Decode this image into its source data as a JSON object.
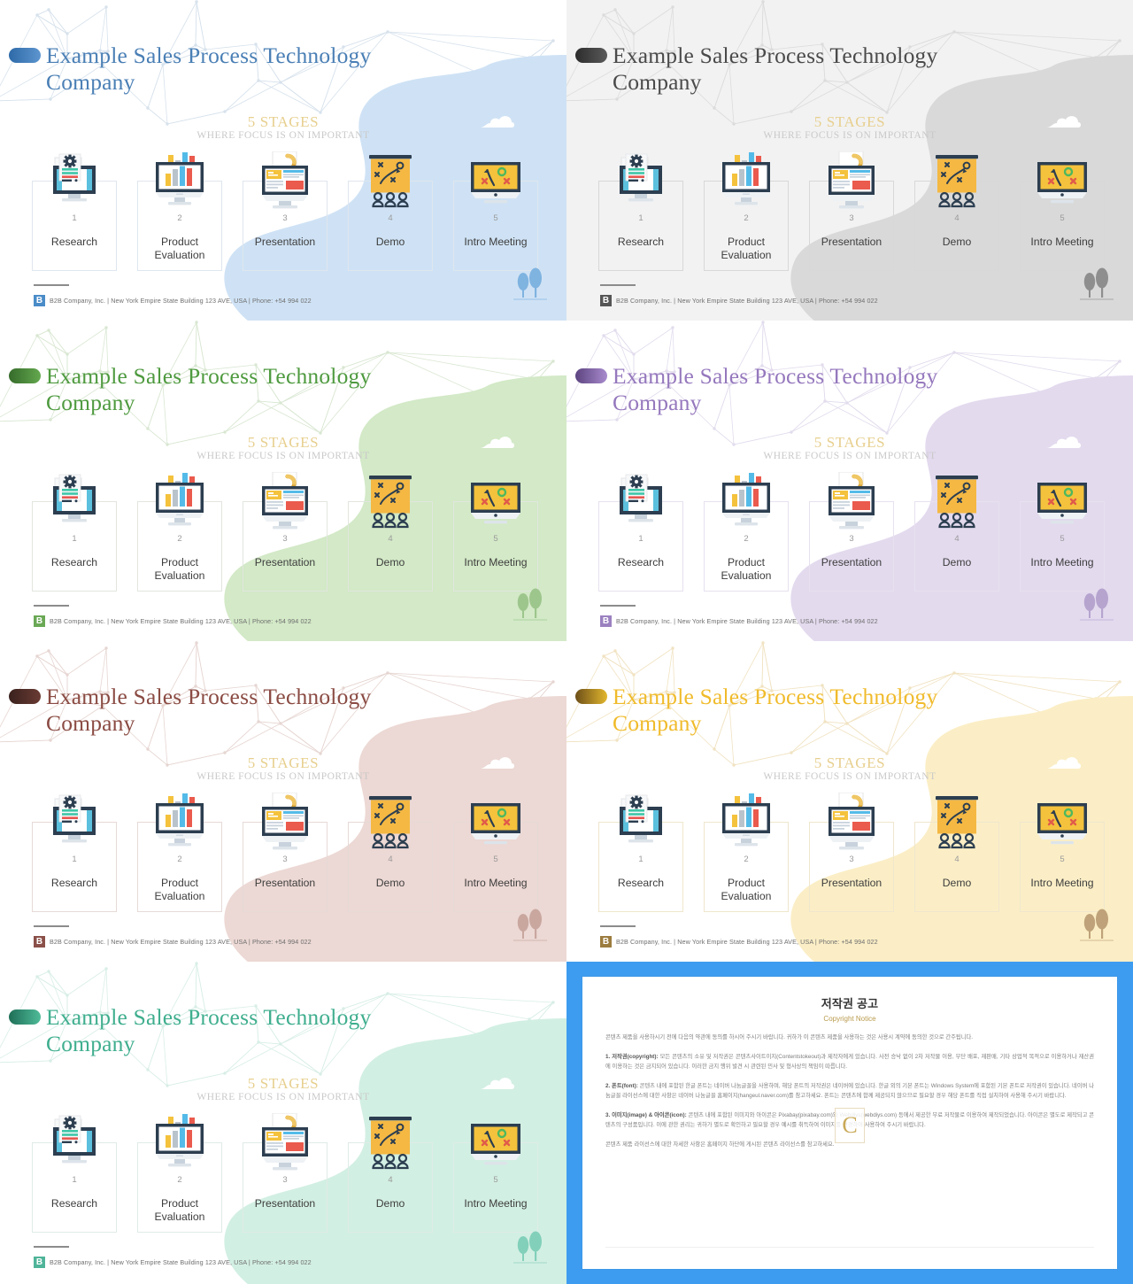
{
  "deck": {
    "title": "Example Sales Process Technology\nCompany",
    "stages_title": "5 STAGES",
    "stages_subtitle": "WHERE FOCUS  IS ON IMPORTANT",
    "footer_logo": "B",
    "footer_text": "B2B Company, Inc.  |  New York Empire State Building 123 AVE, USA  |  Phone: +54 994 022",
    "stages": [
      {
        "num": "1",
        "label": "Research",
        "icon": "monitor-document-gear-icon"
      },
      {
        "num": "2",
        "label": "Product\nEvaluation",
        "icon": "monitor-bar-chart-icon"
      },
      {
        "num": "3",
        "label": "Presentation",
        "icon": "monitor-webpage-hook-icon"
      },
      {
        "num": "4",
        "label": "Demo",
        "icon": "flipchart-strategy-people-icon"
      },
      {
        "num": "5",
        "label": "Intro Meeting",
        "icon": "monitor-strategy-icon"
      }
    ]
  },
  "variants": [
    {
      "name": "blue",
      "title_color": "#4a7fb5",
      "pill_from": "#5d95cf",
      "pill_to": "#2e6aa8",
      "blob": "#cfe2f5",
      "net": "#d7e2ec",
      "card_border": "#dfe6ee",
      "slide_bg": "#ffffff",
      "tree": "#7fb3e0",
      "logo_bg": "#4a8cc8",
      "cloud": "#ffffff"
    },
    {
      "name": "gray",
      "title_color": "#4a4a4a",
      "pill_from": "#5a5a5a",
      "pill_to": "#2c2c2c",
      "blob": "#d9d9d9",
      "net": "#dcdcdc",
      "card_border": "#d8d8d8",
      "slide_bg": "#f2f2f2",
      "tree": "#8e8e8e",
      "logo_bg": "#555555",
      "cloud": "#ffffff"
    },
    {
      "name": "green",
      "title_color": "#4e9a3f",
      "pill_from": "#64a84f",
      "pill_to": "#356b2a",
      "blob": "#d3e9c7",
      "net": "#d9e7d2",
      "card_border": "#e1e6de",
      "slide_bg": "#ffffff",
      "tree": "#9dc68c",
      "logo_bg": "#6aa855",
      "cloud": "#ffffff"
    },
    {
      "name": "purple",
      "title_color": "#9578bd",
      "pill_from": "#a88bcd",
      "pill_to": "#5c4480",
      "blob": "#e3daee",
      "net": "#e2dced",
      "card_border": "#e7e1ef",
      "slide_bg": "#ffffff",
      "tree": "#b6a4cf",
      "logo_bg": "#9b81c0",
      "cloud": "#ffffff"
    },
    {
      "name": "maroon",
      "title_color": "#8a4b43",
      "pill_from": "#6a3b34",
      "pill_to": "#3a211d",
      "blob": "#ecd8d4",
      "net": "#e6d6d2",
      "card_border": "#e6dad7",
      "slide_bg": "#ffffff",
      "tree": "#c9a79f",
      "logo_bg": "#8a5049",
      "cloud": "#ffffff"
    },
    {
      "name": "yellow",
      "title_color": "#f0bb2b",
      "pill_from": "#e2b72e",
      "pill_to": "#6d4f18",
      "blob": "#fbeec6",
      "net": "#f1e3c2",
      "card_border": "#efe6cd",
      "slide_bg": "#ffffff",
      "tree": "#bfa279",
      "logo_bg": "#9c7c3f",
      "cloud": "#ffffff"
    },
    {
      "name": "teal",
      "title_color": "#3fae8e",
      "pill_from": "#4fbb99",
      "pill_to": "#1e6e56",
      "blob": "#d2efe3",
      "net": "#d8eee6",
      "card_border": "#dfebe7",
      "slide_bg": "#ffffff",
      "tree": "#82d0ba",
      "logo_bg": "#4fb499",
      "cloud": "#ffffff"
    }
  ],
  "copyright": {
    "accent": "#3e9cf0",
    "heading": "저작권 공고",
    "subheading": "Copyright Notice",
    "watermark": "C",
    "intro": "콘텐츠 제품을 사용하시기 전에 다음의 약관에 동의를 하시어 주시기 바랍니다. 귀하가 이 콘텐츠 제품을 사용하는 것은 사용시 계약에 동의한 것으로 간주됩니다.",
    "items": [
      {
        "label": "1. 저작권(copyright):",
        "text": " 모든 콘텐츠의 소유 및 저작권은 콘텐츠사이트이지(Contentstokeout)과 제작자에게 있습니다. 사전 승낙 없이 2차 저작물 이용, 무단 배포, 재판매, 기타 상업적 목적으로 이용하거나 재산권에 이용하는 것은 금지되어 있습니다. 이러한 금지 행위 발견 시 관련된 민사 및 형사상의 책임이 따릅니다."
      },
      {
        "label": "2. 폰트(font):",
        "text": " 콘텐츠 내에 포함된 한글 폰트는 네이버 나눔글꼴을 사용하며, 해당 폰트의 저작권은 네이버에 있습니다. 한글 외의 기본 폰트는 Windows System에 포함된 기본 폰트로 저작권이 있습니다. 네이버 나눔글꼴 라이선스에 대한 사항은 네이버 나눔글꼴 홈페이지(hangeul.naver.com)를 참고하세요. 폰트는 콘텐츠에 함께 제공되지 않으므로 필요할 경우 해당 폰트를 직접 설치하여 사용해 주시기 바랍니다."
      },
      {
        "label": "3. 이미지(image) & 아이콘(icon):",
        "text": " 콘텐츠 내에 포함된 이미지와 아이콘은 Pixabay(pixabay.com)와 Webdiys(webdiys.com) 등에서 제공한 무료 저작물로 이용하여 제작되었습니다. 아이콘은 별도로 제작되고 콘텐츠의 구성품입니다. 이에 관한 권리는 귀하가 별도로 확인하고 필요할 경우 예시를 취득하여 이미지를 변경하여 사용하여 주시기 바랍니다."
      }
    ],
    "outro": "콘텐츠 제품 라이선스에 대한 자세한 사항은 홈페이지 하단에 게시된 콘텐츠 라이선스를 참고하세요."
  }
}
